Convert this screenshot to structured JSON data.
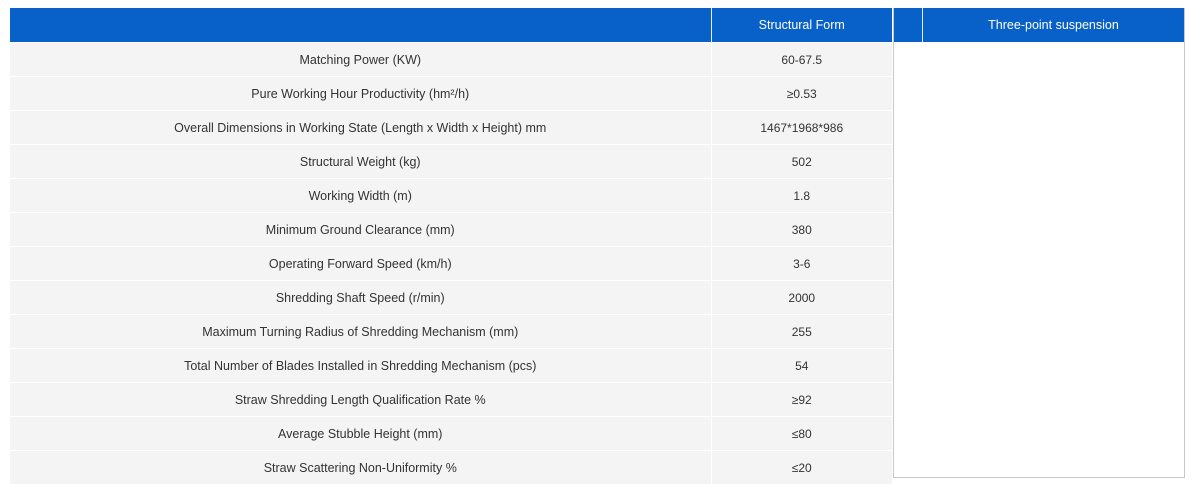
{
  "header": {
    "param_label": "",
    "structural_form_label": "Structural Form",
    "suspension_label": "Three-point suspension"
  },
  "rows": [
    {
      "param": "Matching Power (KW)",
      "value": "60-67.5"
    },
    {
      "param": "Pure Working Hour Productivity (hm²/h)",
      "value": "≥0.53"
    },
    {
      "param": "Overall Dimensions in Working State (Length x Width x Height) mm",
      "value": "1467*1968*986"
    },
    {
      "param": "Structural Weight (kg)",
      "value": "502"
    },
    {
      "param": "Working Width (m)",
      "value": "1.8"
    },
    {
      "param": "Minimum Ground Clearance (mm)",
      "value": "380"
    },
    {
      "param": "Operating Forward Speed (km/h)",
      "value": "3-6"
    },
    {
      "param": "Shredding Shaft Speed (r/min)",
      "value": "2000"
    },
    {
      "param": "Maximum Turning Radius of Shredding Mechanism (mm)",
      "value": "255"
    },
    {
      "param": "Total Number of Blades Installed in Shredding Mechanism (pcs)",
      "value": "54"
    },
    {
      "param": "Straw Shredding Length Qualification Rate %",
      "value": "≥92"
    },
    {
      "param": "Average Stubble Height (mm)",
      "value": "≤80"
    },
    {
      "param": "Straw Scattering Non-Uniformity %",
      "value": "≤20"
    }
  ],
  "colors": {
    "header_bg": "#0860c9",
    "row_bg": "#f4f4f4",
    "text": "#333333"
  }
}
